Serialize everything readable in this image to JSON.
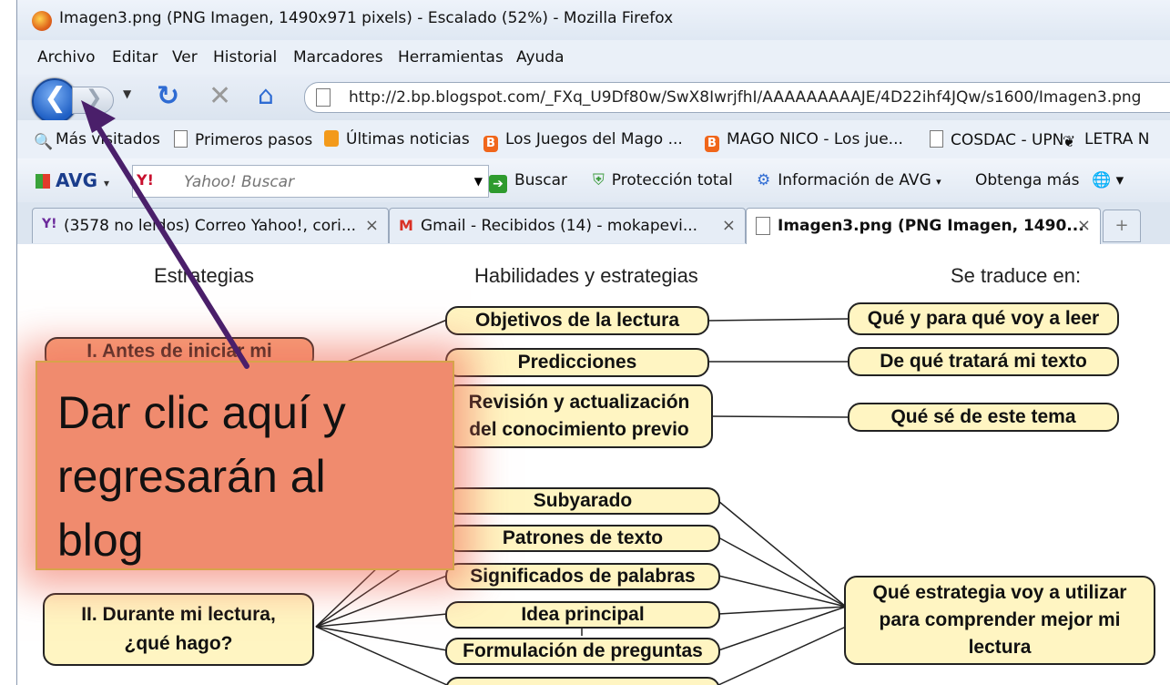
{
  "window": {
    "title": "Imagen3.png (PNG Imagen, 1490x971 pixels) - Escalado (52%) - Mozilla Firefox"
  },
  "menubar": {
    "items": [
      {
        "label": "Archivo"
      },
      {
        "label": "Editar"
      },
      {
        "label": "Ver"
      },
      {
        "label": "Historial"
      },
      {
        "label": "Marcadores"
      },
      {
        "label": "Herramientas"
      },
      {
        "label": "Ayuda"
      }
    ]
  },
  "navbar": {
    "back_glyph": "❮",
    "forward_glyph": "❯",
    "url": "http://2.bp.blogspot.com/_FXq_U9Df80w/SwX8IwrjfhI/AAAAAAAAAJE/4D22ihf4JQw/s1600/Imagen3.png"
  },
  "bookmarks": [
    {
      "label": "Más visitados",
      "icon": "magnifier-icon"
    },
    {
      "label": "Primeros pasos",
      "icon": "page-icon"
    },
    {
      "label": "Últimas noticias",
      "icon": "rss-icon"
    },
    {
      "label": "Los Juegos del Mago ...",
      "icon": "blogger-icon"
    },
    {
      "label": "MAGO NICO - Los jue...",
      "icon": "blogger-icon"
    },
    {
      "label": "COSDAC - UPN",
      "icon": "page-icon"
    },
    {
      "label": "LETRA N",
      "icon": "butterfly-icon"
    }
  ],
  "avg_toolbar": {
    "logo": "AVG",
    "yahoo_logo": "Y!",
    "search_placeholder": "Yahoo! Buscar",
    "search_button": "Buscar",
    "protection": "Protección total",
    "info": "Información de AVG",
    "more": "Obtenga más"
  },
  "tabs": [
    {
      "label": "(3578 no leídos) Correo Yahoo!, cori...",
      "icon": "yahoo-icon",
      "active": false
    },
    {
      "label": "Gmail - Recibidos (14) - mokapevi...",
      "icon": "gmail-icon",
      "active": false
    },
    {
      "label": "Imagen3.png (PNG Imagen, 1490...",
      "icon": "page-icon",
      "active": true
    }
  ],
  "diagram": {
    "headers": {
      "left": "Estrategias",
      "middle": "Habilidades y estrategias",
      "right": "Se traduce en:"
    },
    "left_nodes": {
      "before": "I. Antes de iniciar mi",
      "during_line1": "II. Durante mi lectura,",
      "during_line2": "¿qué hago?"
    },
    "middle_nodes": {
      "objetivos": "Objetivos de la lectura",
      "predicciones": "Predicciones",
      "revision_line1": "Revisión y actualización",
      "revision_line2": "del conocimiento previo",
      "subrayado": "Subyarado",
      "patrones": "Patrones de texto",
      "significados": "Significados de palabras",
      "idea": "Idea principal",
      "formulacion": "Formulación de preguntas"
    },
    "right_nodes": {
      "que_para_que": "Qué y para qué voy a leer",
      "de_que_tratara": "De qué tratará mi texto",
      "que_se": "Qué sé de este tema",
      "estrategia_line1": "Qué estrategia voy a utilizar",
      "estrategia_line2": "para comprender mejor mi",
      "estrategia_line3": "lectura"
    }
  },
  "callout": {
    "line1": "Dar clic aquí y",
    "line2": "regresarán al",
    "line3": "blog"
  },
  "colors": {
    "arrow": "#4a1f6a",
    "callout_bg": "#f08b6e",
    "node_bg": "#fff5c2"
  }
}
